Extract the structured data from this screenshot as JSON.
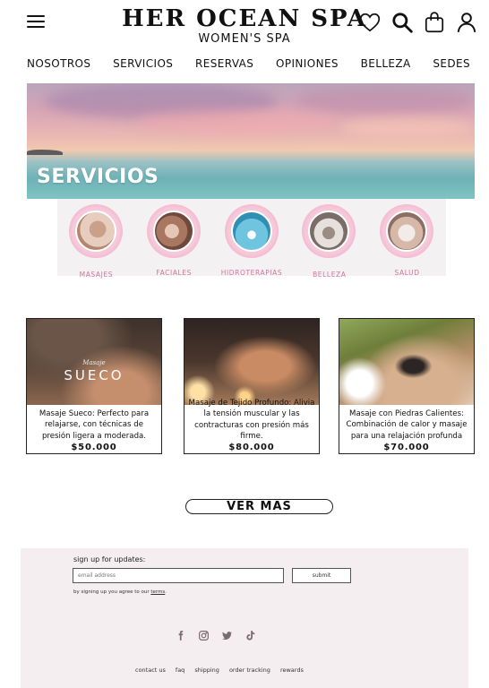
{
  "brand": {
    "title": "HER OCEAN SPA",
    "subtitle": "WOMEN'S SPA"
  },
  "header_icons": [
    "menu-icon",
    "heart-icon",
    "search-icon",
    "bag-icon",
    "user-icon"
  ],
  "nav": [
    "NOSOTROS",
    "SERVICIOS",
    "RESERVAS",
    "OPINIONES",
    "BELLEZA",
    "SEDES"
  ],
  "hero": {
    "title": "SERVICIOS"
  },
  "categories": [
    "MASAJES",
    "FACIALES",
    "HIDROTERAPIAS",
    "BELLEZA",
    "SALUD"
  ],
  "cards": [
    {
      "overlay_small": "Masaje",
      "overlay_big": "SUECO",
      "text": "Masaje Sueco: Perfecto para relajarse, con técnicas de presión ligera a moderada.",
      "price": "$50.000"
    },
    {
      "text": "Masaje de Tejido Profundo: Alivia la tensión muscular y las contracturas con presión más firme.",
      "price": "$80.000"
    },
    {
      "text": "Masaje con Piedras Calientes: Combinación de calor y masaje para una relajación profunda",
      "price": "$70.000"
    }
  ],
  "cta": {
    "label": "VER MAS"
  },
  "footer": {
    "signup_label": "sign up for updates:",
    "email_placeholder": "email address",
    "submit_label": "submit",
    "agree_prefix": "by signing up you agree to our ",
    "agree_link": "terms",
    "agree_suffix": ".",
    "social": [
      "facebook-icon",
      "instagram-icon",
      "twitter-icon",
      "tiktok-icon"
    ],
    "links": [
      "contact us",
      "faq",
      "shipping",
      "order tracking",
      "rewards"
    ]
  },
  "colors": {
    "accent_pink": "#d1769b",
    "footer_bg": "#f5eef0",
    "category_bg": "#f4f1f3"
  }
}
